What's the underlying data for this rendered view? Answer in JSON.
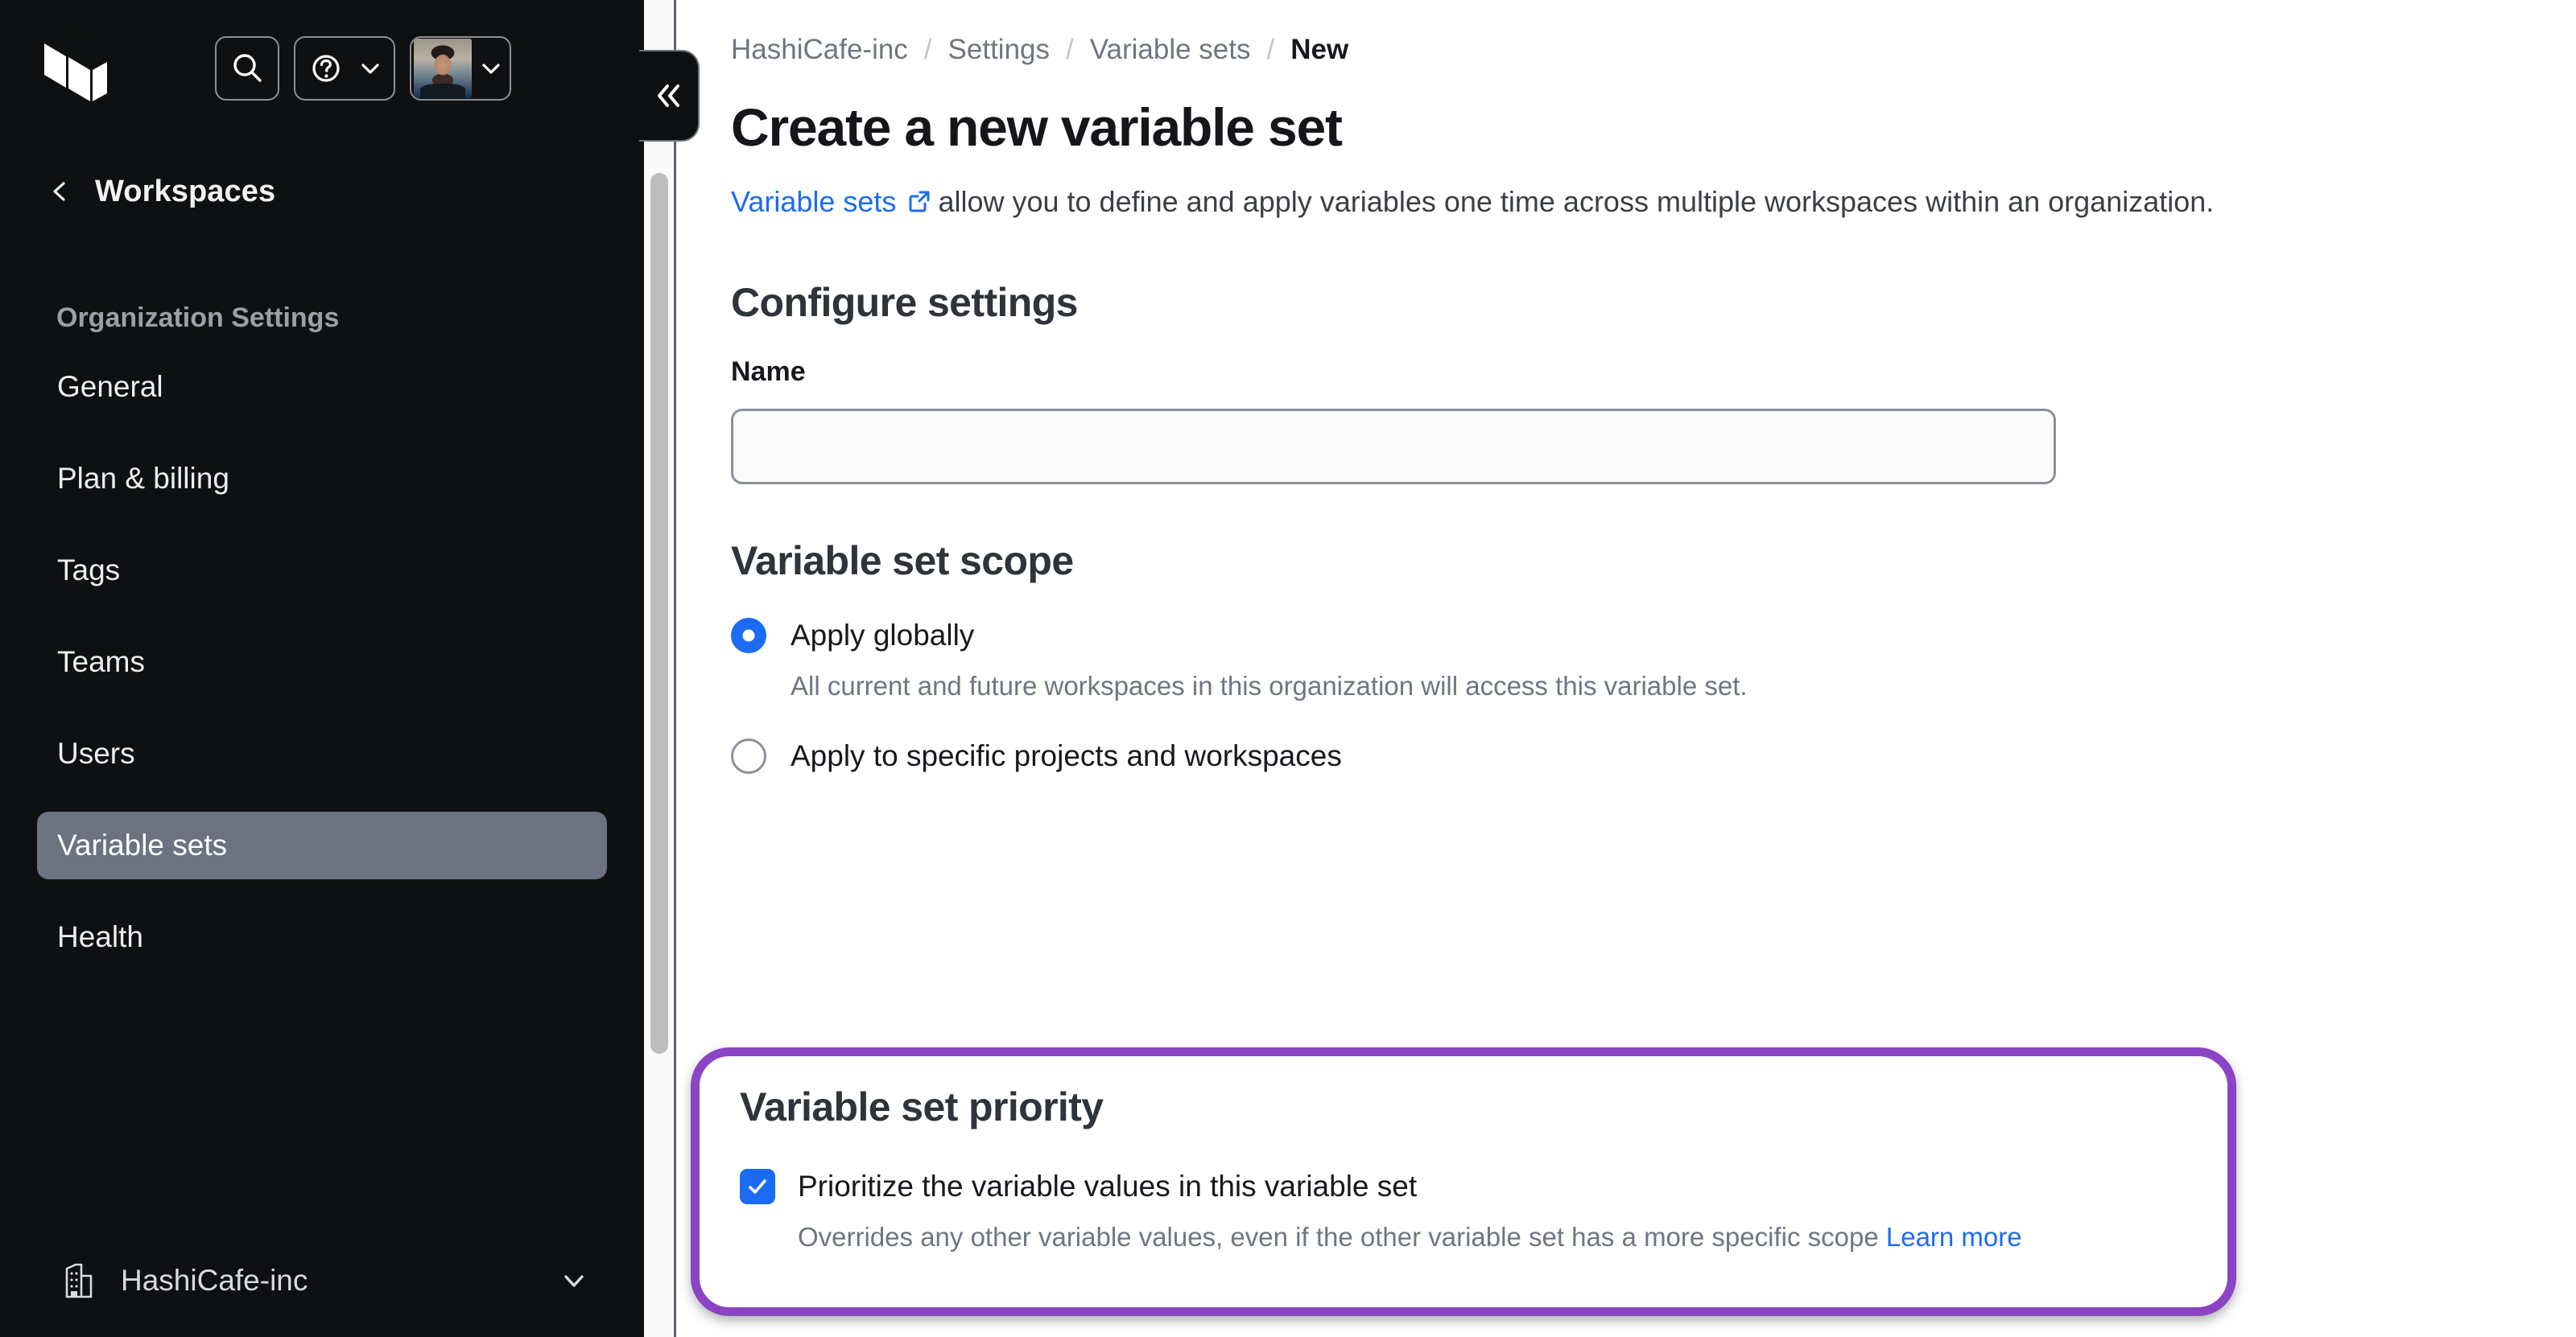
{
  "sidebar": {
    "logo_icon": "terraform-logo",
    "search_icon": "search-icon",
    "help_icon": "help-circle-icon",
    "help_chevron_icon": "chevron-down-icon",
    "avatar_icon": "user-avatar",
    "avatar_chevron_icon": "chevron-down-icon",
    "collapse_icon": "double-chevron-left-icon",
    "back": {
      "icon": "chevron-left-icon",
      "label": "Workspaces"
    },
    "section_label": "Organization Settings",
    "items": [
      {
        "label": "General",
        "active": false
      },
      {
        "label": "Plan & billing",
        "active": false
      },
      {
        "label": "Tags",
        "active": false
      },
      {
        "label": "Teams",
        "active": false
      },
      {
        "label": "Users",
        "active": false
      },
      {
        "label": "Variable sets",
        "active": true
      },
      {
        "label": "Health",
        "active": false
      }
    ],
    "org": {
      "icon": "building-icon",
      "name": "HashiCafe-inc",
      "chevron_icon": "chevron-down-icon"
    }
  },
  "breadcrumb": {
    "items": [
      "HashiCafe-inc",
      "Settings",
      "Variable sets",
      "New"
    ],
    "separator": "/"
  },
  "main": {
    "page_title": "Create a new variable set",
    "description": {
      "link_text": "Variable sets",
      "external_icon": "external-link-icon",
      "rest": "allow you to define and apply variables one time across multiple workspaces within an organization."
    },
    "configure_settings": {
      "heading": "Configure settings",
      "name_label": "Name",
      "name_value": "",
      "name_placeholder": ""
    },
    "scope": {
      "heading": "Variable set scope",
      "options": [
        {
          "label": "Apply globally",
          "selected": true,
          "help": "All current and future workspaces in this organization will access this variable set."
        },
        {
          "label": "Apply to specific projects and workspaces",
          "selected": false,
          "help": ""
        }
      ]
    },
    "priority": {
      "heading": "Variable set priority",
      "checkbox_label": "Prioritize the variable values in this variable set",
      "checkbox_checked": true,
      "check_icon": "checkmark-icon",
      "help_text": "Overrides any other variable values, even if the other variable set has a more specific scope",
      "help_link": "Learn more"
    }
  },
  "colors": {
    "sidebar_bg": "#0f1011",
    "active_item_bg": "#6b7280",
    "link_blue": "#1b6cf2",
    "annotation_purple": "#8b44c4",
    "page_bg": "#ffffff"
  }
}
